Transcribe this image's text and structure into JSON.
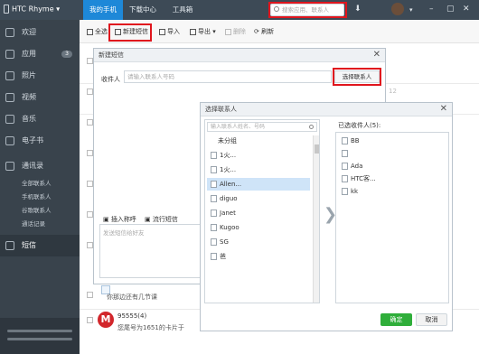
{
  "app": {
    "title": "HTC Rhyme"
  },
  "topnav": {
    "tabs": [
      "我的手机",
      "下载中心",
      "工具箱"
    ],
    "search_placeholder": "搜索应用、联系人"
  },
  "sidebar": {
    "items": [
      {
        "label": "欢迎"
      },
      {
        "label": "应用",
        "badge": "3"
      },
      {
        "label": "照片"
      },
      {
        "label": "视频"
      },
      {
        "label": "音乐"
      },
      {
        "label": "电子书"
      },
      {
        "label": "通讯录"
      },
      {
        "label": "短信"
      }
    ],
    "sub_items": [
      "全部联系人",
      "手机联系人",
      "谷歌联系人",
      "通话记录"
    ]
  },
  "toolbar": {
    "select_all": "全选",
    "new_sms": "新建短信",
    "import": "导入",
    "export": "导出",
    "delete": "删除",
    "refresh": "刷新"
  },
  "list": {
    "row_text_1": "你那边还有几节课",
    "row_name_2": "95555(4)",
    "row_text_2": "您尾号为1651的卡片于",
    "stray_digits": "12"
  },
  "compose": {
    "title": "新建短信",
    "recipient_label": "收件人",
    "recipient_placeholder": "请输入联系人号码",
    "select_contacts": "选择联系人",
    "insert_greeting": "插入称呼",
    "popular_sms": "流行短信",
    "message_placeholder": "发送短信给好友"
  },
  "select_dialog": {
    "title": "选择联系人",
    "search_placeholder": "输入联系人姓名、号码",
    "group_label": "未分组",
    "contacts": [
      "1火...",
      "1火...",
      "Allen...",
      "diguo",
      "Janet",
      "Kugoo",
      "SG",
      "爸"
    ],
    "selected_label": "已选收件人(5):",
    "selected": [
      "BB",
      "",
      "Ada",
      "HTC客...",
      "kk"
    ],
    "ok": "确定",
    "cancel": "取消"
  }
}
